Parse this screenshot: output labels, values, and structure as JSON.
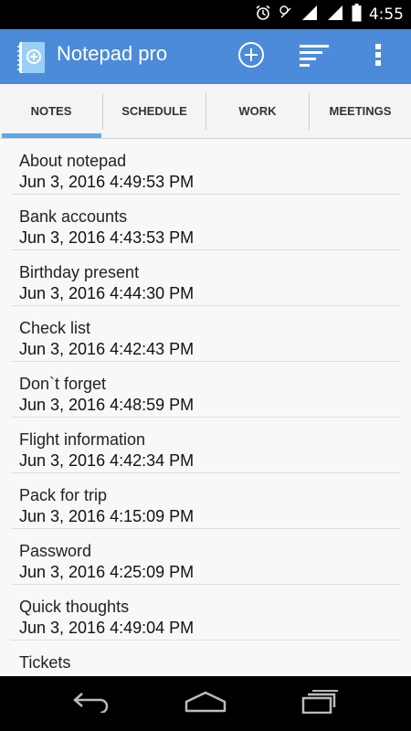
{
  "status_bar": {
    "time": "4:55",
    "icons": [
      "alarm-icon",
      "signal-icon",
      "wifi-icon",
      "battery-icon"
    ]
  },
  "app_bar": {
    "title": "Notepad pro",
    "icons": [
      "notepad-app-icon",
      "add-circle-icon",
      "sort-icon",
      "overflow-menu-icon"
    ],
    "color": "#4c8bd9"
  },
  "tabs": [
    {
      "label": "NOTES",
      "selected": true
    },
    {
      "label": "SCHEDULE",
      "selected": false
    },
    {
      "label": "WORK",
      "selected": false
    },
    {
      "label": "MEETINGS",
      "selected": false
    }
  ],
  "notes": [
    {
      "title": "About notepad",
      "date": "Jun 3, 2016 4:49:53 PM"
    },
    {
      "title": "Bank accounts",
      "date": "Jun 3, 2016 4:43:53 PM"
    },
    {
      "title": "Birthday present",
      "date": "Jun 3, 2016 4:44:30 PM"
    },
    {
      "title": "Check list",
      "date": "Jun 3, 2016 4:42:43 PM"
    },
    {
      "title": "Don`t forget",
      "date": "Jun 3, 2016 4:48:59 PM"
    },
    {
      "title": "Flight information",
      "date": "Jun 3, 2016 4:42:34 PM"
    },
    {
      "title": "Pack for trip",
      "date": "Jun 3, 2016 4:15:09 PM"
    },
    {
      "title": "Password",
      "date": "Jun 3, 2016 4:25:09 PM"
    },
    {
      "title": "Quick thoughts",
      "date": "Jun 3, 2016 4:49:04 PM"
    },
    {
      "title": "Tickets",
      "date": ""
    }
  ],
  "nav_bar": {
    "icons": [
      "back-icon",
      "home-icon",
      "recents-icon"
    ]
  },
  "colors": {
    "accent": "#4c8bd9",
    "tab_indicator": "#5fa6e6"
  }
}
